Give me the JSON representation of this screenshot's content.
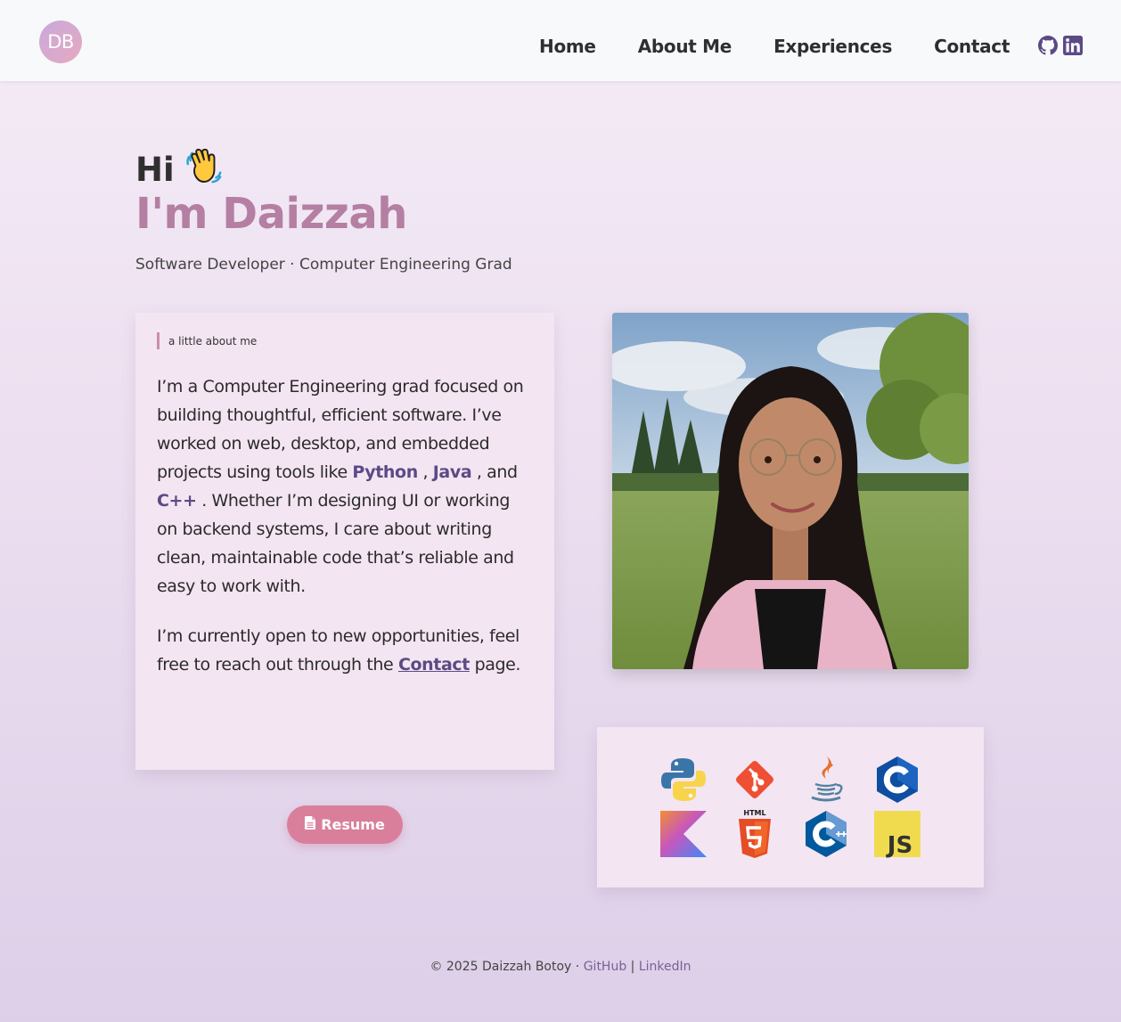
{
  "header": {
    "logo_text": "DB",
    "nav": [
      {
        "label": "Home"
      },
      {
        "label": "About Me"
      },
      {
        "label": "Experiences"
      },
      {
        "label": "Contact"
      }
    ],
    "social_icons": [
      "github-icon",
      "linkedin-icon"
    ],
    "icon_color": "#5c4a86"
  },
  "hero": {
    "greeting": "Hi",
    "greeting_emoji": "👋",
    "name": "I'm Daizzah",
    "subtitle": "Software Developer · Computer Engineering Grad"
  },
  "about": {
    "tag": "a little about me",
    "p1_before": "I’m a Computer Engineering grad focused on building thoughtful, efficient software. I’ve worked on web, desktop, and embedded projects using tools like ",
    "lang1": "Python",
    "sep1": " , ",
    "lang2": "Java",
    "sep2": " , and ",
    "lang3": "C++",
    "p1_after": " . Whether I’m designing UI or working on backend systems, I care about writing clean, maintainable code that’s reliable and easy to work with.",
    "p2_before": "I’m currently open to new opportunities, feel free to reach out through the ",
    "p2_link": "Contact",
    "p2_after": " page."
  },
  "resume": {
    "label": "Resume",
    "icon": "file-icon"
  },
  "photo": {
    "alt": "Portrait photo"
  },
  "skills": {
    "icons": [
      "python-icon",
      "git-icon",
      "java-icon",
      "c-icon",
      "kotlin-icon",
      "html5-icon",
      "cplusplus-icon",
      "javascript-icon"
    ],
    "html5_label": "HTML",
    "js_label": "JS"
  },
  "footer": {
    "copyright": "© 2025 Daizzah Botoy · ",
    "github": "GitHub",
    "separator": " | ",
    "linkedin": "LinkedIn"
  },
  "colors": {
    "accent_name": "#b47fa3",
    "link": "#5c4a86",
    "resume_button": "#d97f9c",
    "card_bg": "#f4e5f2"
  }
}
